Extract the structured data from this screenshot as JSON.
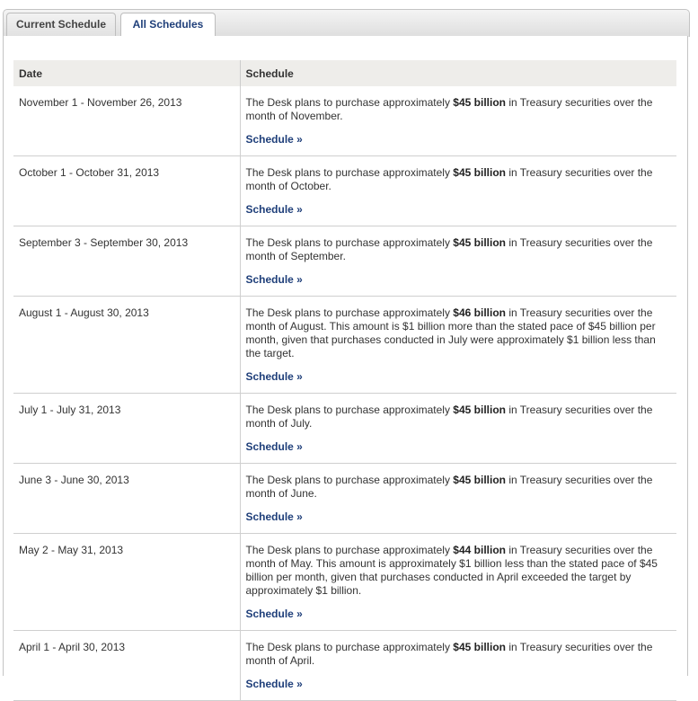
{
  "tabs": {
    "current": "Current Schedule",
    "all": "All Schedules"
  },
  "table": {
    "headers": {
      "date": "Date",
      "schedule": "Schedule"
    },
    "rows": [
      {
        "date": "November 1 - November 26, 2013",
        "pre": "The Desk plans to purchase approximately ",
        "amount": "$45 billion",
        "post": " in Treasury securities over the month of November.",
        "link": "Schedule »"
      },
      {
        "date": "October 1 - October 31, 2013",
        "pre": "The Desk plans to purchase approximately ",
        "amount": "$45 billion",
        "post": " in Treasury securities over the month of October.",
        "link": "Schedule »"
      },
      {
        "date": "September 3 - September 30, 2013",
        "pre": "The Desk plans to purchase approximately ",
        "amount": "$45 billion",
        "post": " in Treasury securities over the month of September.",
        "link": "Schedule »"
      },
      {
        "date": "August 1 - August 30, 2013",
        "pre": "The Desk plans to purchase approximately ",
        "amount": "$46 billion",
        "post": " in Treasury securities over the month of August. This amount is $1 billion more than the stated pace of $45 billion per month, given that purchases conducted in July were approximately $1 billion less than the target.",
        "link": "Schedule »"
      },
      {
        "date": "July 1 - July 31, 2013",
        "pre": "The Desk plans to purchase approximately ",
        "amount": "$45 billion",
        "post": " in Treasury securities over the month of July.",
        "link": "Schedule »"
      },
      {
        "date": "June 3 - June 30, 2013",
        "pre": "The Desk plans to purchase approximately ",
        "amount": "$45 billion",
        "post": " in Treasury securities over the month of June.",
        "link": "Schedule »"
      },
      {
        "date": "May 2 - May 31, 2013",
        "pre": "The Desk plans to purchase approximately ",
        "amount": "$44 billion",
        "post": " in Treasury securities over the month of May. This amount is approximately $1 billion less than the stated pace of $45 billion per month, given that purchases conducted in April exceeded the target by approximately $1 billion.",
        "link": "Schedule »"
      },
      {
        "date": "April 1 - April 30, 2013",
        "pre": "The Desk plans to purchase approximately ",
        "amount": "$45 billion",
        "post": " in Treasury securities over the month of April.",
        "link": "Schedule »"
      }
    ]
  }
}
